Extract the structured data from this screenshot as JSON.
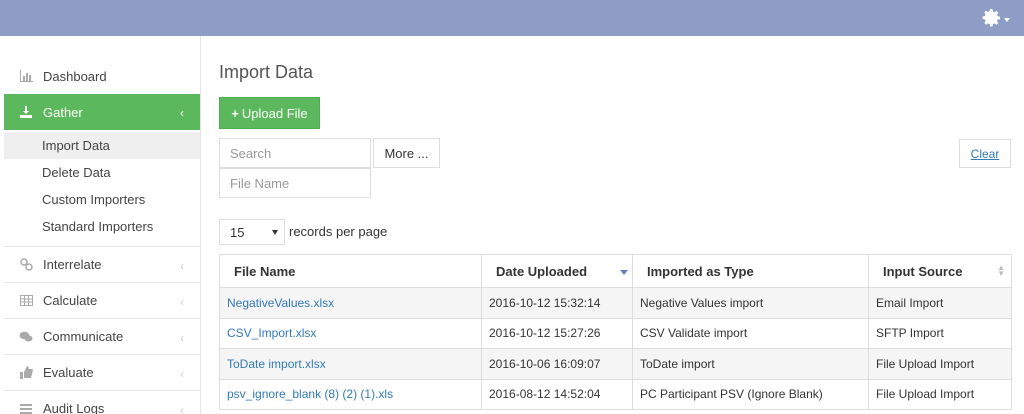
{
  "header": {
    "settings_icon": "gear-icon"
  },
  "sidebar": {
    "items": [
      {
        "label": "Dashboard",
        "icon": "bar-chart-icon"
      },
      {
        "label": "Gather",
        "icon": "download-icon",
        "active": true
      },
      {
        "label": "Interrelate",
        "icon": "link-icon"
      },
      {
        "label": "Calculate",
        "icon": "table-icon"
      },
      {
        "label": "Communicate",
        "icon": "comments-icon"
      },
      {
        "label": "Evaluate",
        "icon": "thumbs-up-icon"
      },
      {
        "label": "Audit Logs",
        "icon": "list-icon"
      }
    ],
    "gather_submenu": [
      "Import Data",
      "Delete Data",
      "Custom Importers",
      "Standard Importers"
    ]
  },
  "main": {
    "title": "Import Data",
    "upload_label": "Upload File",
    "search_placeholder": "Search",
    "filename_placeholder": "File Name",
    "more_label": "More ...",
    "clear_label": "Clear",
    "per_page_value": "15",
    "per_page_label": "records per page"
  },
  "table": {
    "columns": [
      "File Name",
      "Date Uploaded",
      "Imported as Type",
      "Input Source"
    ],
    "rows": [
      [
        "NegativeValues.xlsx",
        "2016-10-12 15:32:14",
        "Negative Values import",
        "Email Import"
      ],
      [
        "CSV_Import.xlsx",
        "2016-10-12 15:27:26",
        "CSV Validate import",
        "SFTP Import"
      ],
      [
        "ToDate import.xlsx",
        "2016-10-06 16:09:07",
        "ToDate import",
        "File Upload Import"
      ],
      [
        "psv_ignore_blank (8) (2) (1).xls",
        "2016-08-12 14:52:04",
        "PC Participant PSV (Ignore Blank)",
        "File Upload Import"
      ]
    ]
  },
  "colors": {
    "topbar": "#8e9dc6",
    "accent_green": "#5cb85c",
    "link": "#337ab7"
  }
}
